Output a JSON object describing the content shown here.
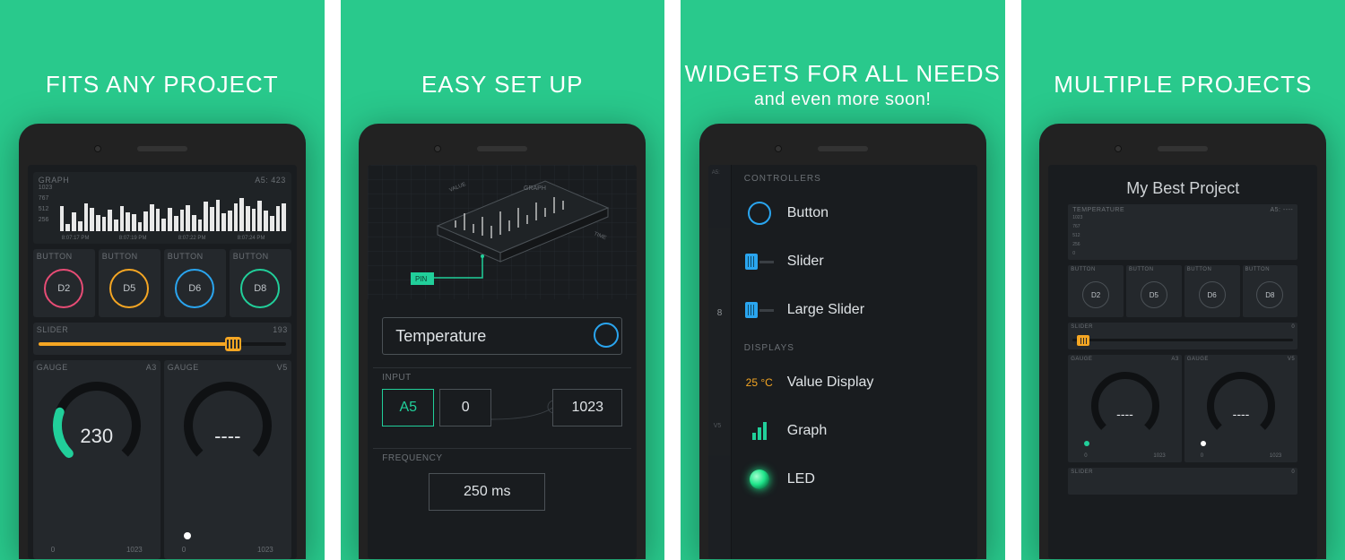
{
  "panels": [
    {
      "headline": "FITS ANY PROJECT"
    },
    {
      "headline": "EASY SET UP"
    },
    {
      "headline": "WIDGETS FOR ALL NEEDS",
      "sub": "and even more soon!"
    },
    {
      "headline": "MULTIPLE PROJECTS"
    }
  ],
  "p1": {
    "graph": {
      "label": "GRAPH",
      "pin": "A5:",
      "value": "423",
      "ylabels": [
        "1023",
        "767",
        "512",
        "256"
      ],
      "xlabels": [
        "8:07:17 PM",
        "8:07:19 PM",
        "8:07:22 PM",
        "8:07:24 PM"
      ]
    },
    "buttonLabel": "BUTTON",
    "buttons": [
      {
        "pin": "D2",
        "color": "#e74c75"
      },
      {
        "pin": "D5",
        "color": "#f5a623"
      },
      {
        "pin": "D6",
        "color": "#2aa5ef"
      },
      {
        "pin": "D8",
        "color": "#21cf9a"
      }
    ],
    "slider": {
      "label": "SLIDER",
      "value": "193"
    },
    "gauges": [
      {
        "label": "GAUGE",
        "pin": "A3",
        "value": "230",
        "lo": "0",
        "hi": "1023"
      },
      {
        "label": "GAUGE",
        "pin": "V5",
        "value": "----",
        "lo": "0",
        "hi": "1023"
      }
    ]
  },
  "p2": {
    "name": "Temperature",
    "inputLabel": "INPUT",
    "freqLabel": "FREQUENCY",
    "pin": "A5",
    "low": "0",
    "high": "1023",
    "freq": "250 ms",
    "iso": {
      "tag": "GRAPH",
      "valueAxis": "VALUE",
      "timeAxis": "TIME",
      "pinTag": "PIN"
    }
  },
  "p3": {
    "peekPin": "8",
    "peekPinFull": "V5",
    "sections": {
      "controllers": {
        "label": "CONTROLLERS",
        "items": [
          {
            "icon": "button",
            "name": "Button"
          },
          {
            "icon": "slider",
            "name": "Slider"
          },
          {
            "icon": "large-slider",
            "name": "Large Slider"
          }
        ]
      },
      "displays": {
        "label": "DISPLAYS",
        "items": [
          {
            "icon": "value",
            "name": "Value Display",
            "sample": "25 °C"
          },
          {
            "icon": "graph",
            "name": "Graph"
          },
          {
            "icon": "led",
            "name": "LED"
          }
        ]
      }
    }
  },
  "p4": {
    "title": "My Best Project",
    "graph": {
      "label": "TEMPERATURE",
      "pin": "A5:",
      "value": "----",
      "ylabels": [
        "1023",
        "767",
        "512",
        "256",
        "0"
      ]
    },
    "buttonLabel": "BUTTON",
    "buttons": [
      {
        "pin": "D2"
      },
      {
        "pin": "D5"
      },
      {
        "pin": "D6"
      },
      {
        "pin": "D8"
      }
    ],
    "slider": {
      "label": "SLIDER",
      "value": "0"
    },
    "gauges": [
      {
        "label": "GAUGE",
        "pin": "A3",
        "value": "----",
        "lo": "0",
        "hi": "1023"
      },
      {
        "label": "GAUGE",
        "pin": "V5",
        "value": "----",
        "lo": "0",
        "hi": "1023"
      }
    ],
    "slider2": {
      "label": "SLIDER",
      "value": "0"
    }
  },
  "chart_data": {
    "type": "bar",
    "title": "GRAPH",
    "ylabel": "",
    "xlabel": "",
    "ylim": [
      0,
      1023
    ],
    "categories": [
      "8:07:17 PM",
      "",
      "8:07:19 PM",
      "",
      "8:07:22 PM",
      "",
      "8:07:24 PM"
    ],
    "values": [
      640,
      190,
      480,
      260,
      720,
      600,
      410,
      380,
      550,
      300,
      660,
      500,
      450,
      240,
      520,
      700,
      580,
      330,
      610,
      390,
      560,
      680,
      430,
      300,
      760,
      620,
      820,
      460,
      540,
      710,
      870,
      650,
      590,
      780,
      530,
      400,
      640,
      720
    ]
  }
}
